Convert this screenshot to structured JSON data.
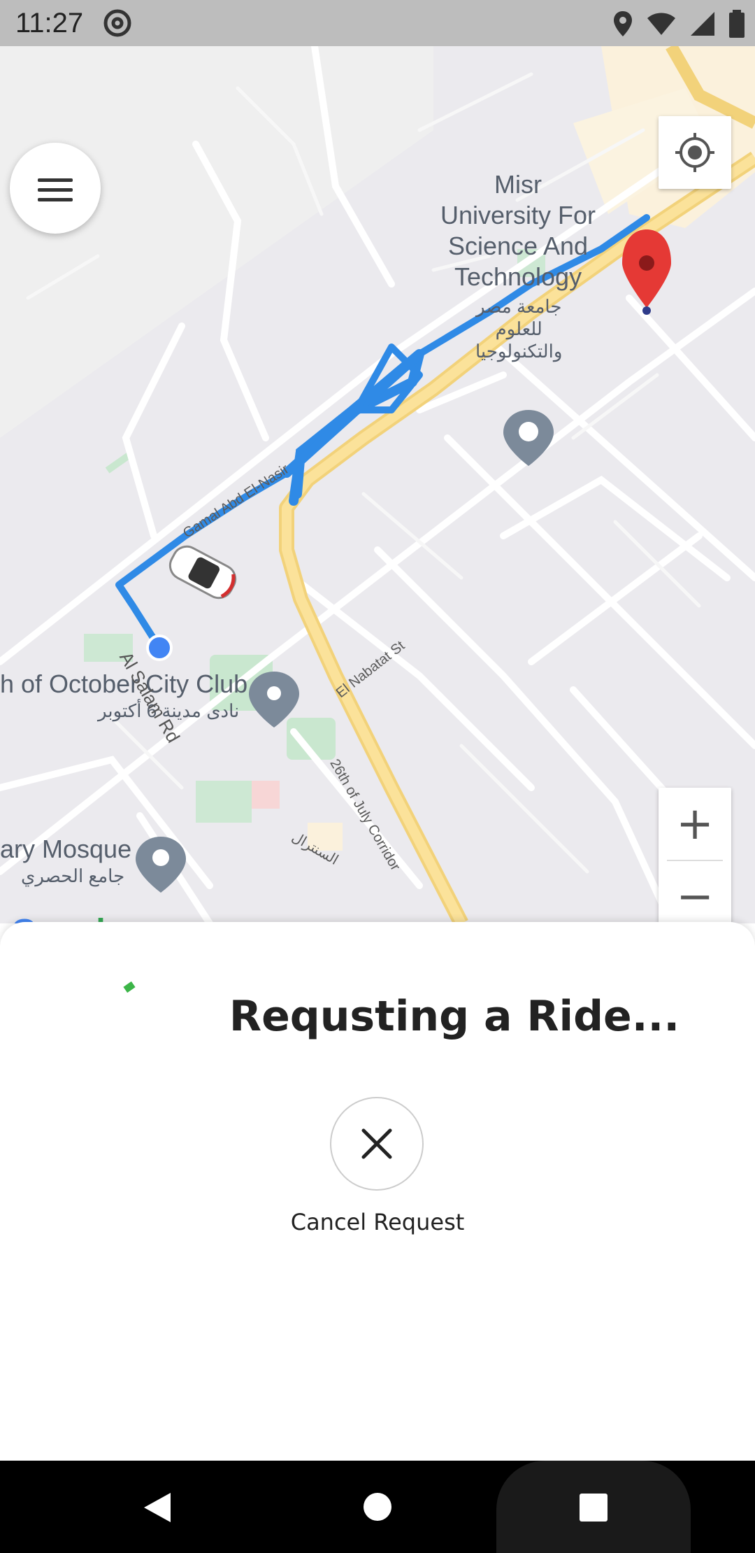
{
  "status_bar": {
    "time": "11:27",
    "icons": [
      "at-sign-icon",
      "location-icon",
      "wifi-icon",
      "signal-icon",
      "battery-icon"
    ]
  },
  "map": {
    "labels": {
      "university_en": "Misr\nUniversity For\nScience And\nTechnology",
      "university_ar": "جامعة مصر\nللعلوم\nوالتكنولوجيا",
      "club_en": "h of October City Club",
      "club_ar": "نادى مدينة 6 أكتوبر",
      "mosque_en": "ary Mosque",
      "mosque_ar": "جامع الحصري",
      "road_gamal": "Gamal Abd El-Nasir",
      "road_alsalam": "Al Salam Rd",
      "road_nabatat": "El Nabatat St",
      "road_26july": "26th of July Corridor",
      "road_arabic": "السنترال"
    },
    "google_logo": "Google"
  },
  "controls": {
    "menu": "menu-icon",
    "my_location": "crosshair-icon",
    "zoom_in": "+",
    "zoom_out": "−"
  },
  "sheet": {
    "title": "Requsting a Ride...",
    "cancel_label": "Cancel Request"
  },
  "colors": {
    "route": "#2f8ae6",
    "pin": "#e53935",
    "accent": "#3cb548"
  }
}
